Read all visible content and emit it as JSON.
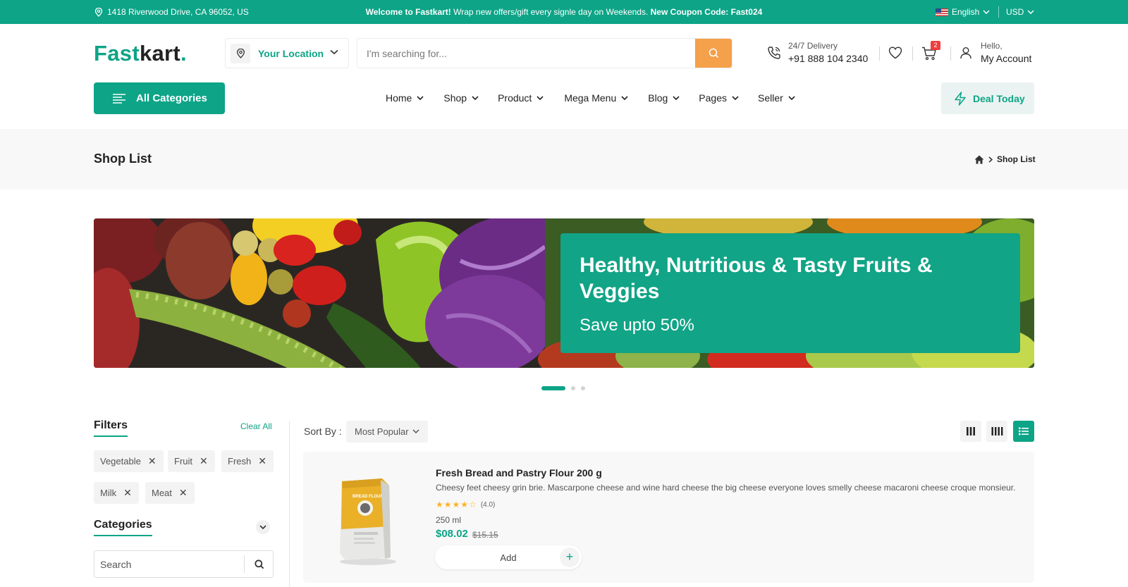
{
  "topbar": {
    "address": "1418 Riverwood Drive, CA 96052, US",
    "welcome_bold": "Welcome to Fastkart!",
    "welcome_text": " Wrap new offers/gift every signle day on Weekends. ",
    "coupon": "New Coupon Code: Fast024",
    "language": "English",
    "currency": "USD"
  },
  "header": {
    "logo_first": "Fast",
    "logo_rest": "kart",
    "logo_dot": ".",
    "location_label": "Your Location",
    "search_placeholder": "I'm searching for...",
    "delivery_label": "24/7 Delivery",
    "delivery_phone": "+91 888 104 2340",
    "cart_count": "2",
    "account_hello": "Hello,",
    "account_label": "My Account"
  },
  "nav": {
    "all_categories": "All Categories",
    "items": [
      "Home",
      "Shop",
      "Product",
      "Mega Menu",
      "Blog",
      "Pages",
      "Seller"
    ],
    "deal": "Deal Today"
  },
  "breadcrumb": {
    "title": "Shop List",
    "current": "Shop List"
  },
  "banner": {
    "headline": "Healthy, Nutritious & Tasty Fruits & Veggies",
    "subline": "Save upto 50%",
    "slides": 3,
    "active_slide": 1
  },
  "filters": {
    "title": "Filters",
    "clear_all": "Clear All",
    "chips": [
      "Vegetable",
      "Fruit",
      "Fresh",
      "Milk",
      "Meat"
    ],
    "categories_title": "Categories",
    "search_placeholder": "Search"
  },
  "sort": {
    "label": "Sort By :",
    "value": "Most Popular"
  },
  "product": {
    "name": "Fresh Bread and Pastry Flour 200 g",
    "description": "Cheesy feet cheesy grin brie. Mascarpone cheese and wine hard cheese the big cheese everyone loves smelly cheese macaroni cheese croque monsieur.",
    "rating": 4,
    "rating_text": "(4.0)",
    "unit": "250 ml",
    "price": "$08.02",
    "old_price": "$15.15",
    "add_label": "Add",
    "plus": "+",
    "package_text": "BREAD FLOUR"
  },
  "colors": {
    "brand": "#0da487",
    "search_button": "#f5a04a",
    "badge": "#ef3f3e",
    "star": "#ffb321"
  }
}
